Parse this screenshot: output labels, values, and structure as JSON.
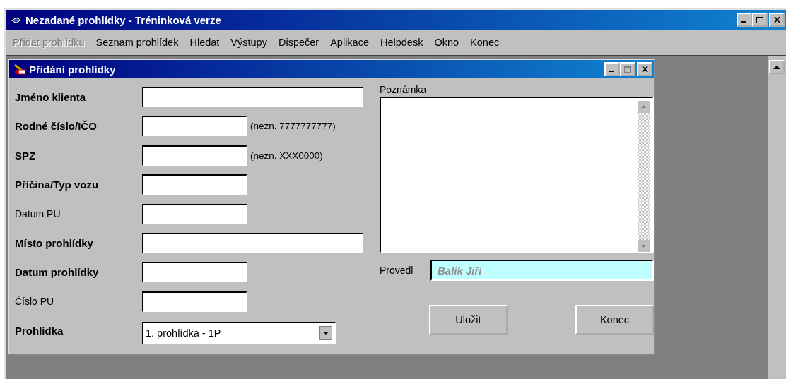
{
  "window": {
    "title": "Nezadané prohlídky - Tréninková verze"
  },
  "menu": [
    {
      "label": "Přidat prohlídku",
      "disabled": true
    },
    {
      "label": "Seznam prohlídek",
      "disabled": false
    },
    {
      "label": "Hledat",
      "disabled": false
    },
    {
      "label": "Výstupy",
      "disabled": false
    },
    {
      "label": "Dispečer",
      "disabled": false
    },
    {
      "label": "Aplikace",
      "disabled": false
    },
    {
      "label": "Helpdesk",
      "disabled": false
    },
    {
      "label": "Okno",
      "disabled": false
    },
    {
      "label": "Konec",
      "disabled": false
    }
  ],
  "dialog": {
    "title": "Přidání prohlídky",
    "fields": [
      {
        "label": "Jméno klienta",
        "bold": true,
        "kind": "long"
      },
      {
        "label": "Rodné číslo/IČO",
        "bold": true,
        "kind": "short",
        "hint": "(nezn. 7777777777)"
      },
      {
        "label": "SPZ",
        "bold": true,
        "kind": "short",
        "hint": "(nezn. XXX0000)"
      },
      {
        "label": "Příčina/Typ vozu",
        "bold": true,
        "kind": "short"
      },
      {
        "label": "Datum PU",
        "bold": false,
        "kind": "short"
      },
      {
        "label": "Místo prohlídky",
        "bold": true,
        "kind": "long"
      },
      {
        "label": "Datum prohlídky",
        "bold": true,
        "kind": "short"
      },
      {
        "label": "Číslo PU",
        "bold": false,
        "kind": "short"
      },
      {
        "label": "Prohlídka",
        "bold": true,
        "kind": "combo",
        "value": "1. prohlídka - 1P"
      }
    ],
    "note": {
      "label": "Poznámka"
    },
    "performer": {
      "label": "Provedl",
      "value": "Balík Jiří"
    },
    "buttons": [
      "Uložit",
      "Konec"
    ]
  }
}
